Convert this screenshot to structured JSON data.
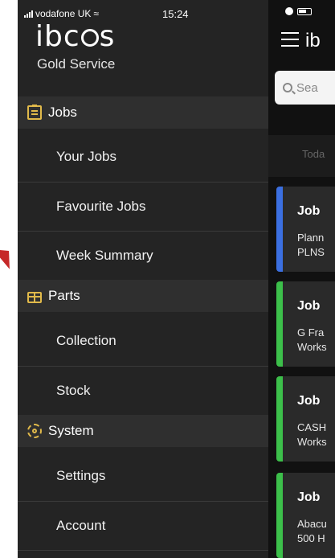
{
  "status_bar": {
    "carrier": "vodafone UK",
    "time": "15:24"
  },
  "drawer": {
    "brand": {
      "logo_prefix": "ibc",
      "logo_suffix": "s",
      "subtitle": "Gold Service"
    },
    "sections": [
      {
        "title": "Jobs",
        "icon": "clipboard-icon",
        "items": [
          "Your Jobs",
          "Favourite Jobs",
          "Week Summary"
        ]
      },
      {
        "title": "Parts",
        "icon": "box-icon",
        "items": [
          "Collection",
          "Stock"
        ]
      },
      {
        "title": "System",
        "icon": "gear-icon",
        "items": [
          "Settings",
          "Account"
        ]
      }
    ]
  },
  "main": {
    "app_abbr": "ib",
    "search_placeholder": "Sea",
    "tab_today": "Toda",
    "cards": [
      {
        "title": "Job",
        "line1": "Plann",
        "line2": "PLNS",
        "accent": "#3b6fe0"
      },
      {
        "title": "Job",
        "line1": "G Fra",
        "line2": "Works",
        "accent": "#3cbf4a"
      },
      {
        "title": "Job",
        "line1": "CASH",
        "line2": "Works",
        "accent": "#3cbf4a"
      },
      {
        "title": "Job",
        "line1": "Abacu",
        "line2": "500 H",
        "accent": "#3cbf4a"
      }
    ]
  },
  "colors": {
    "icon_accent": "#e0b94a",
    "arrow": "#c62828"
  }
}
